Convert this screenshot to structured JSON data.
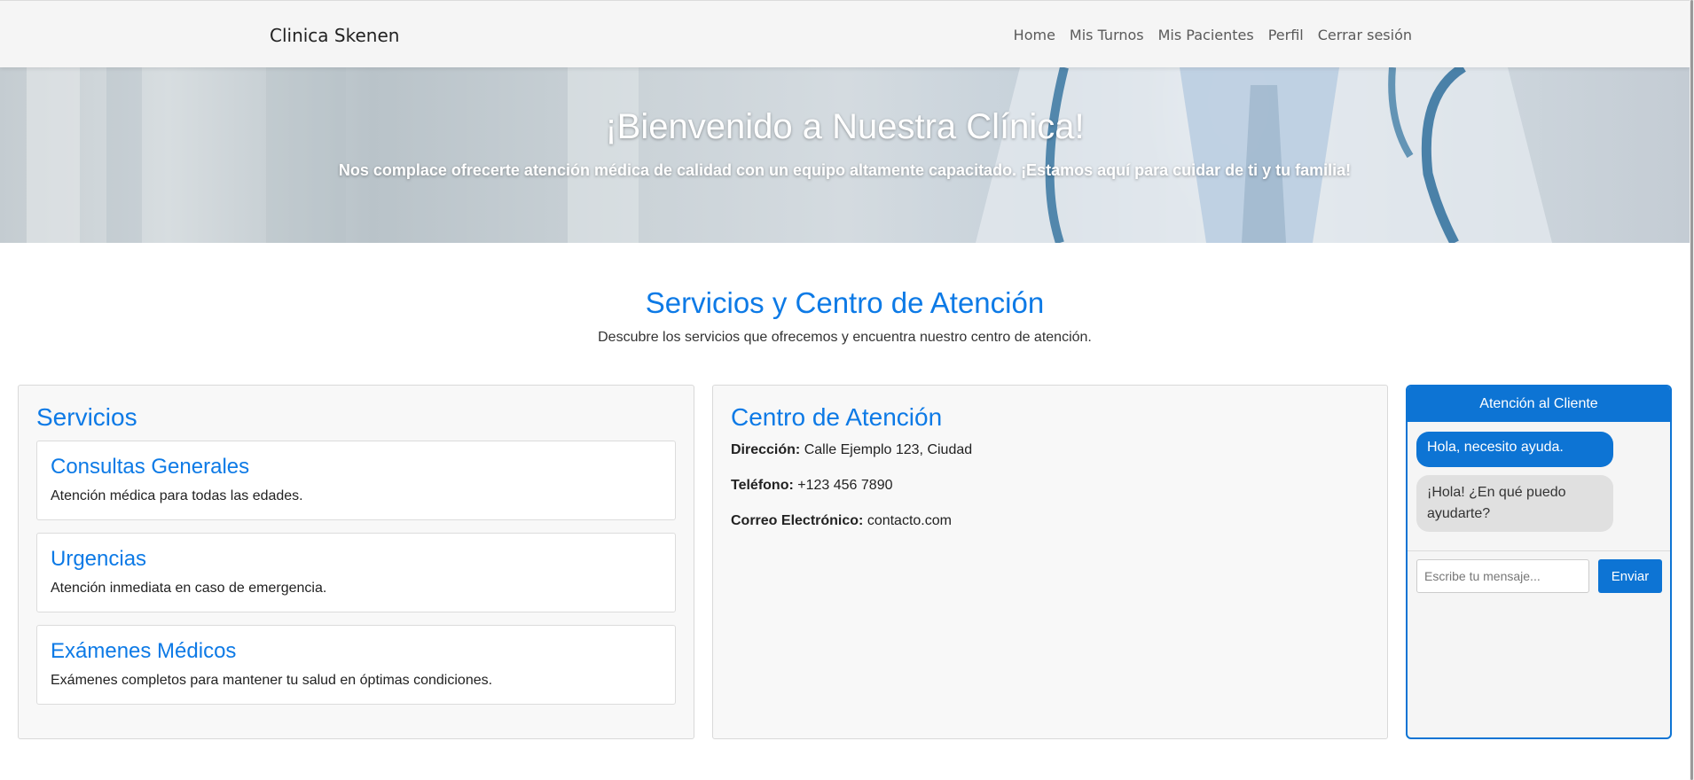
{
  "navbar": {
    "brand": "Clinica Skenen",
    "links": [
      "Home",
      "Mis Turnos",
      "Mis Pacientes",
      "Perfil",
      "Cerrar sesión"
    ]
  },
  "hero": {
    "title": "¡Bienvenido a Nuestra Clínica!",
    "subtitle": "Nos complace ofrecerte atención médica de calidad con un equipo altamente capacitado. ¡Estamos aquí para cuidar de ti y tu familia!"
  },
  "section": {
    "title": "Servicios y Centro de Atención",
    "description": "Descubre los servicios que ofrecemos y encuentra nuestro centro de atención."
  },
  "services": {
    "title": "Servicios",
    "items": [
      {
        "name": "Consultas Generales",
        "description": "Atención médica para todas las edades."
      },
      {
        "name": "Urgencias",
        "description": "Atención inmediata en caso de emergencia."
      },
      {
        "name": "Exámenes Médicos",
        "description": "Exámenes completos para mantener tu salud en óptimas condiciones."
      }
    ]
  },
  "center": {
    "title": "Centro de Atención",
    "address_label": "Dirección:",
    "address": "Calle Ejemplo 123, Ciudad",
    "phone_label": "Teléfono:",
    "phone": "+123 456 7890",
    "email_label": "Correo Electrónico:",
    "email": "contacto.com"
  },
  "chat": {
    "header": "Atención al Cliente",
    "messages": [
      {
        "from": "user",
        "text": "Hola, necesito ayuda."
      },
      {
        "from": "bot",
        "text": "¡Hola! ¿En qué puedo ayudarte?"
      }
    ],
    "input_placeholder": "Escribe tu mensaje...",
    "send_label": "Enviar"
  },
  "colors": {
    "accent": "#0d7ae6",
    "chat_blue": "#0d74d4",
    "navbar_bg": "#f5f5f5",
    "panel_bg": "#f8f8f8"
  }
}
